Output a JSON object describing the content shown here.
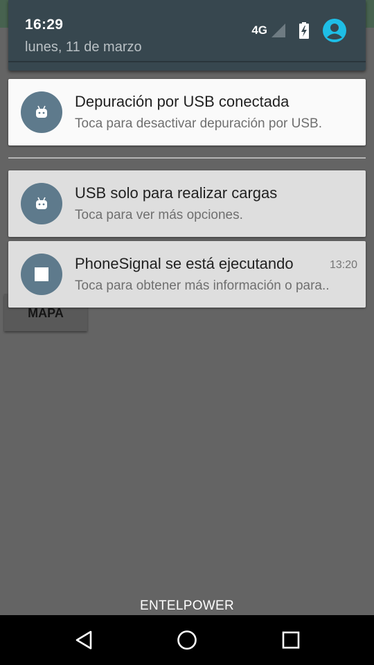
{
  "status": {
    "time": "16:29",
    "date": "lunes, 11 de marzo",
    "network": "4G",
    "icons": [
      "signal-icon",
      "battery-charging-icon",
      "user-account-icon"
    ]
  },
  "background_app": {
    "map_button_label": "MAPA"
  },
  "notifications": [
    {
      "icon": "android-icon",
      "title": "Depuración por USB conectada",
      "text": "Toca para desactivar depuración por USB.",
      "time": ""
    },
    {
      "icon": "android-icon",
      "title": "USB solo para realizar cargas",
      "text": "Toca para ver más opciones.",
      "time": ""
    },
    {
      "icon": "stop-square-icon",
      "title": "PhoneSignal se está ejecutando",
      "text": "Toca para obtener más información o para..",
      "time": "13:20"
    }
  ],
  "carrier": "ENTELPOWER",
  "navbar": {
    "icons": [
      "back-icon",
      "home-icon",
      "recents-icon"
    ]
  },
  "colors": {
    "header_bg": "#37474f",
    "avatar_bg": "#5e7a8c",
    "accent_user": "#1ebee6",
    "scrim": "#646464"
  }
}
